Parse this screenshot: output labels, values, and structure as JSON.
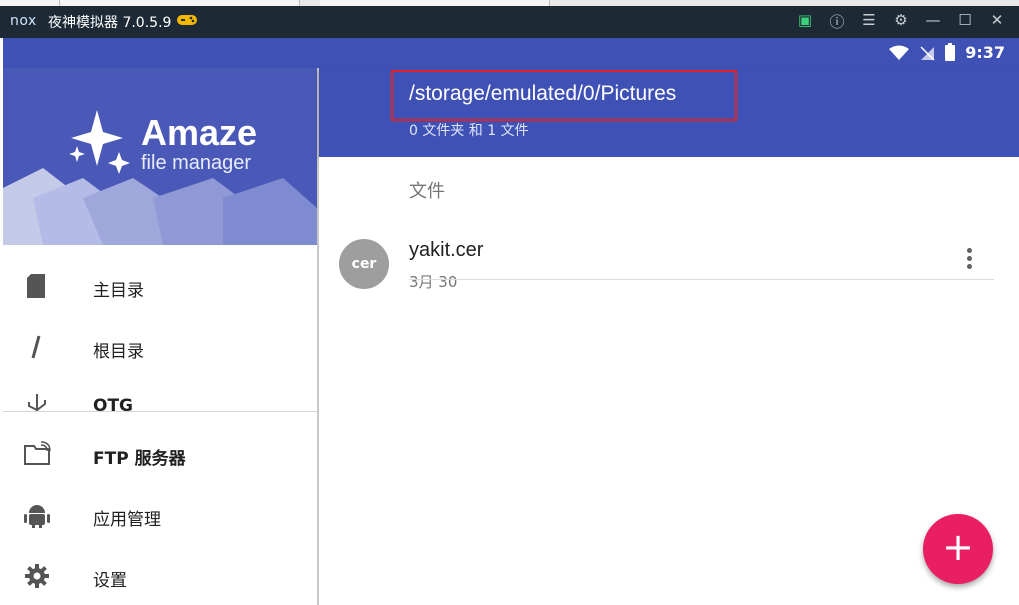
{
  "window": {
    "logo": "nox",
    "title": "夜神模拟器 7.0.5.9",
    "game_icon": "gamepad-icon",
    "controls": [
      "wallet-icon",
      "help-icon",
      "menu-icon",
      "settings-icon",
      "minimize-icon",
      "maximize-icon",
      "close-icon"
    ]
  },
  "status": {
    "time": "9:37"
  },
  "appbar": {
    "path": "/storage/emulated/0/Pictures",
    "subtitle": "0 文件夹 和 1 文件"
  },
  "drawer": {
    "brand_name": "Amaze",
    "brand_sub": "file manager",
    "items": [
      {
        "label": "主目录",
        "icon": "sd-card-icon"
      },
      {
        "label": "根目录",
        "icon": "slash-icon"
      },
      {
        "label": "OTG",
        "icon": "usb-icon"
      },
      {
        "label": "FTP 服务器",
        "icon": "ftp-folder-icon"
      },
      {
        "label": "应用管理",
        "icon": "android-icon"
      },
      {
        "label": "设置",
        "icon": "gear-icon"
      }
    ]
  },
  "content": {
    "section_header": "文件",
    "files": [
      {
        "avatar": "cer",
        "name": "yakit.cer",
        "date": "3月 30"
      }
    ]
  },
  "colors": {
    "primary": "#3f51b5",
    "accent": "#e91e63",
    "highlight_box": "#e02222"
  }
}
